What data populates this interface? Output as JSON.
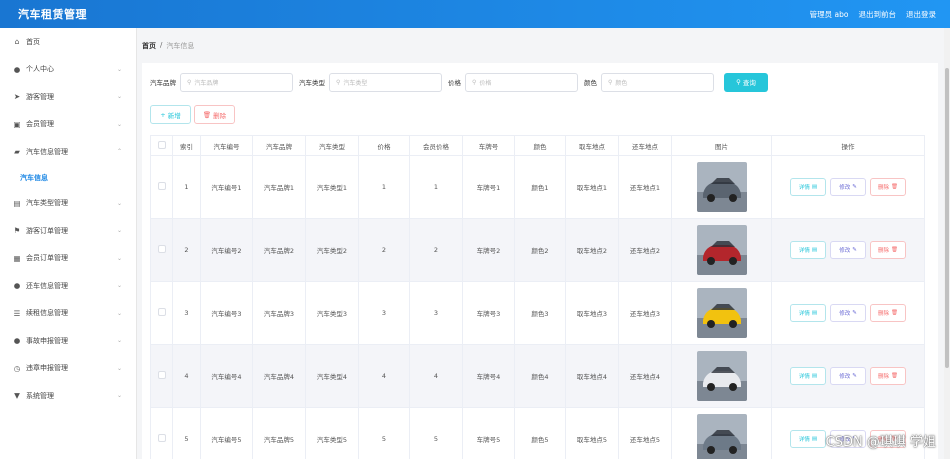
{
  "header": {
    "title": "汽车租赁管理",
    "admin_label": "管理员 abo",
    "front_link": "退出到前台",
    "logout_link": "退出登录"
  },
  "sidebar": {
    "items": [
      {
        "label": "首页",
        "icon": "home-icon",
        "glyph": "⌂",
        "arrow": ""
      },
      {
        "label": "个人中心",
        "icon": "user-icon",
        "glyph": "●",
        "arrow": "⌄"
      },
      {
        "label": "游客管理",
        "icon": "send-icon",
        "glyph": "➤",
        "arrow": "⌄"
      },
      {
        "label": "会员管理",
        "icon": "card-icon",
        "glyph": "▣",
        "arrow": "⌄"
      },
      {
        "label": "汽车信息管理",
        "icon": "car-icon",
        "glyph": "▰",
        "arrow": "⌃"
      },
      {
        "label": "汽车信息",
        "icon": "",
        "glyph": "",
        "arrow": ""
      },
      {
        "label": "汽车类型管理",
        "icon": "list-icon",
        "glyph": "▤",
        "arrow": "⌄"
      },
      {
        "label": "游客订单管理",
        "icon": "flag-icon",
        "glyph": "⚑",
        "arrow": "⌄"
      },
      {
        "label": "会员订单管理",
        "icon": "shop-icon",
        "glyph": "▦",
        "arrow": "⌄"
      },
      {
        "label": "还车信息管理",
        "icon": "person-icon",
        "glyph": "●",
        "arrow": "⌄"
      },
      {
        "label": "续租信息管理",
        "icon": "menu-icon",
        "glyph": "☰",
        "arrow": "⌄"
      },
      {
        "label": "事故申报管理",
        "icon": "pin-icon",
        "glyph": "●",
        "arrow": "⌄"
      },
      {
        "label": "违章申报管理",
        "icon": "clock-icon",
        "glyph": "◷",
        "arrow": "⌄"
      },
      {
        "label": "系统管理",
        "icon": "system-icon",
        "glyph": "▼",
        "arrow": "⌄"
      }
    ]
  },
  "breadcrumb": {
    "home": "首页",
    "sep": "/",
    "current": "汽车信息"
  },
  "search": {
    "brand_label": "汽车品牌",
    "brand_placeholder": "汽车品牌",
    "type_label": "汽车类型",
    "type_placeholder": "汽车类型",
    "price_label": "价格",
    "price_placeholder": "价格",
    "color_label": "颜色",
    "color_placeholder": "颜色",
    "button": "查询"
  },
  "actions": {
    "add": "新增",
    "delete": "删除"
  },
  "table": {
    "headers": [
      "索引",
      "汽车编号",
      "汽车品牌",
      "汽车类型",
      "价格",
      "会员价格",
      "车牌号",
      "颜色",
      "取车地点",
      "还车地点",
      "图片",
      "操作"
    ],
    "op_labels": {
      "detail": "详情",
      "edit": "修改",
      "delete": "删除"
    },
    "rows": [
      {
        "index": "1",
        "code": "汽车编号1",
        "brand": "汽车品牌1",
        "type": "汽车类型1",
        "price": "1",
        "member_price": "1",
        "plate": "车牌号1",
        "color": "颜色1",
        "pickup": "取车地点1",
        "return": "还车地点1",
        "img_color": "#5a6470"
      },
      {
        "index": "2",
        "code": "汽车编号2",
        "brand": "汽车品牌2",
        "type": "汽车类型2",
        "price": "2",
        "member_price": "2",
        "plate": "车牌号2",
        "color": "颜色2",
        "pickup": "取车地点2",
        "return": "还车地点2",
        "img_color": "#b3262c"
      },
      {
        "index": "3",
        "code": "汽车编号3",
        "brand": "汽车品牌3",
        "type": "汽车类型3",
        "price": "3",
        "member_price": "3",
        "plate": "车牌号3",
        "color": "颜色3",
        "pickup": "取车地点3",
        "return": "还车地点3",
        "img_color": "#f2c20f"
      },
      {
        "index": "4",
        "code": "汽车编号4",
        "brand": "汽车品牌4",
        "type": "汽车类型4",
        "price": "4",
        "member_price": "4",
        "plate": "车牌号4",
        "color": "颜色4",
        "pickup": "取车地点4",
        "return": "还车地点4",
        "img_color": "#e8eaee"
      },
      {
        "index": "5",
        "code": "汽车编号5",
        "brand": "汽车品牌5",
        "type": "汽车类型5",
        "price": "5",
        "member_price": "5",
        "plate": "车牌号5",
        "color": "颜色5",
        "pickup": "取车地点5",
        "return": "还车地点5",
        "img_color": "#6d7a88"
      }
    ]
  },
  "colors": {
    "topbar": "#1e88e5",
    "accent": "#26c6da",
    "danger": "#f56c6c",
    "edit": "#6a6ad5"
  },
  "watermark": "CSDN @琪琪 学姐"
}
